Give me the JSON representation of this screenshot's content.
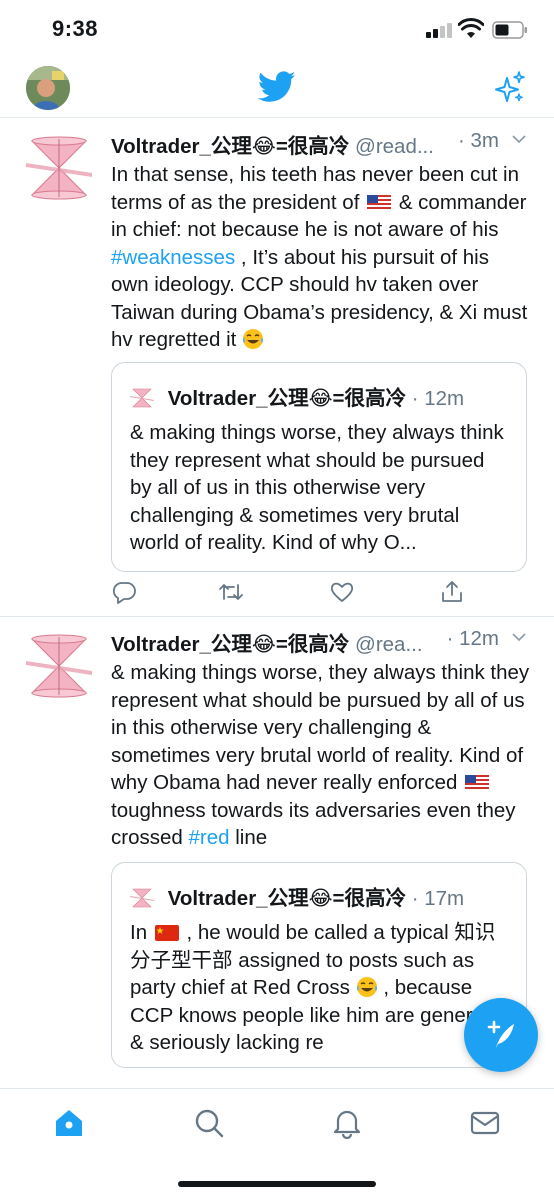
{
  "status_bar": {
    "time": "9:38"
  },
  "header": {
    "logo": "twitter-bird-icon",
    "sparkle": "sparkle-icon"
  },
  "tweets": [
    {
      "name": "Voltrader_公理😂=很高冷",
      "handle": "@read...",
      "time": "· 3m",
      "text_1": "In that sense, his teeth has never been cut in terms of as the president of",
      "text_2": "& commander in chief: not because he is not aware of his",
      "hashtag": "#weaknesses",
      "text_3": ", It’s about his pursuit of his own ideology. CCP should hv taken over Taiwan during Obama’s presidency, & Xi must hv regretted it",
      "quote": {
        "name": "Voltrader_公理😂=很高冷",
        "time": "· 12m",
        "text": "& making things worse, they always think they represent what should be pursued by all of us in this otherwise very challenging & sometimes very brutal world of reality. Kind of why O..."
      }
    },
    {
      "name": "Voltrader_公理😂=很高冷",
      "handle": "@rea...",
      "time": "· 12m",
      "text_1": "& making things worse, they always think they represent what should be pursued by all of us in this otherwise very challenging & sometimes very brutal world of reality. Kind of why Obama had never really enforced",
      "text_2": "toughness towards its adversaries even they crossed",
      "hashtag": "#red",
      "text_3": "line",
      "quote": {
        "name": "Voltrader_公理😂=很高冷",
        "time": "· 17m",
        "text_1": "In",
        "text_2": ", he would be called a typical 知识分子型干部 assigned to posts such as party chief at Red Cross",
        "text_3": ", because CCP knows people like him are generally & seriously lacking re"
      }
    }
  ],
  "icons": {
    "reply": "reply-icon",
    "retweet": "retweet-icon",
    "like": "like-icon",
    "share": "share-icon",
    "compose": "compose-tweet-icon"
  },
  "tabbar": [
    "home-icon",
    "search-icon",
    "notifications-icon",
    "messages-icon"
  ],
  "colors": {
    "accent": "#1da1f2",
    "secondary_text": "#657786",
    "divider": "#e1e8ed"
  }
}
